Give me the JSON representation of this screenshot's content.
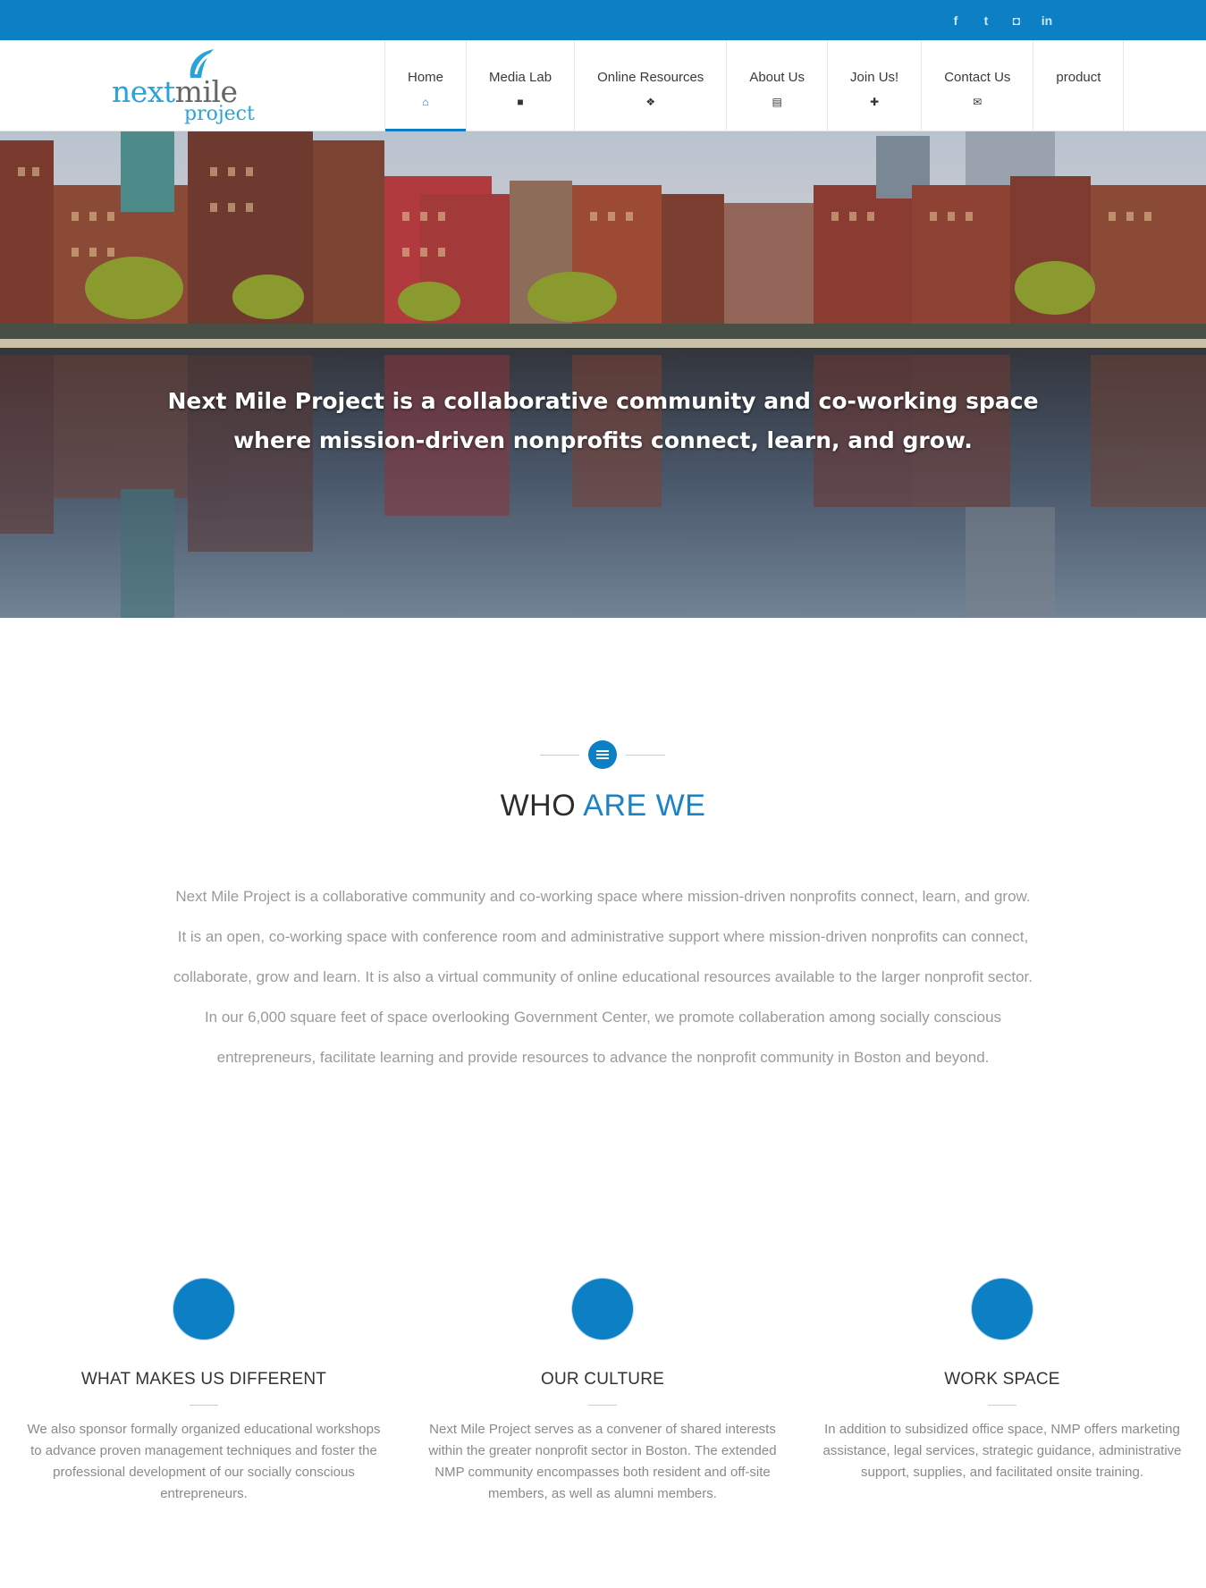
{
  "social": {
    "facebook": "f",
    "twitter": "t",
    "instagram": "◘",
    "linkedin": "in"
  },
  "logo": {
    "line1_a": "next",
    "line1_b": "mile",
    "line2": "project"
  },
  "nav": [
    {
      "label": "Home",
      "icon": "home-icon",
      "glyph": "⌂"
    },
    {
      "label": "Media Lab",
      "icon": "video-camera-icon",
      "glyph": "■"
    },
    {
      "label": "Online Resources",
      "icon": "cubes-icon",
      "glyph": "❖"
    },
    {
      "label": "About Us",
      "icon": "newspaper-icon",
      "glyph": "▤"
    },
    {
      "label": "Join Us!",
      "icon": "user-plus-icon",
      "glyph": "✚"
    },
    {
      "label": "Contact Us",
      "icon": "envelope-icon",
      "glyph": "✉"
    },
    {
      "label": "product",
      "icon": "",
      "glyph": ""
    }
  ],
  "hero": {
    "line1": "Next Mile Project is a collaborative community and co-working space",
    "line2": "where mission-driven nonprofits connect, learn, and grow."
  },
  "who": {
    "title_a": "WHO",
    "title_b": "ARE WE",
    "body": "Next Mile Project is a collaborative community and co-working space where mission-driven nonprofits connect, learn, and grow. It is an open, co-working space with conference room and administrative support where mission-driven nonprofits can connect, collaborate, grow and learn. It is also a virtual community of online educational resources available to the larger nonprofit sector. In our 6,000 square feet of space overlooking Government Center, we promote collaberation among socially conscious entrepreneurs, facilitate learning and provide resources to advance the nonprofit community in Boston and beyond."
  },
  "features": [
    {
      "title": "WHAT MAKES US DIFFERENT",
      "text": "We also sponsor formally organized educational workshops to advance proven management techniques and foster the professional development of our socially conscious entrepreneurs."
    },
    {
      "title": "OUR CULTURE",
      "text": "Next Mile Project serves as a convener of shared interests within the greater nonprofit sector in Boston. The extended NMP community encompasses both resident and off-site members, as well as alumni members."
    },
    {
      "title": "WORK SPACE",
      "text": "In addition to subsidized office space, NMP offers marketing assistance, legal services, strategic guidance, administrative support, supplies, and facilitated onsite training."
    }
  ],
  "colors": {
    "brand_blue": "#0d7fc4",
    "accent_title": "#1b82c5"
  }
}
